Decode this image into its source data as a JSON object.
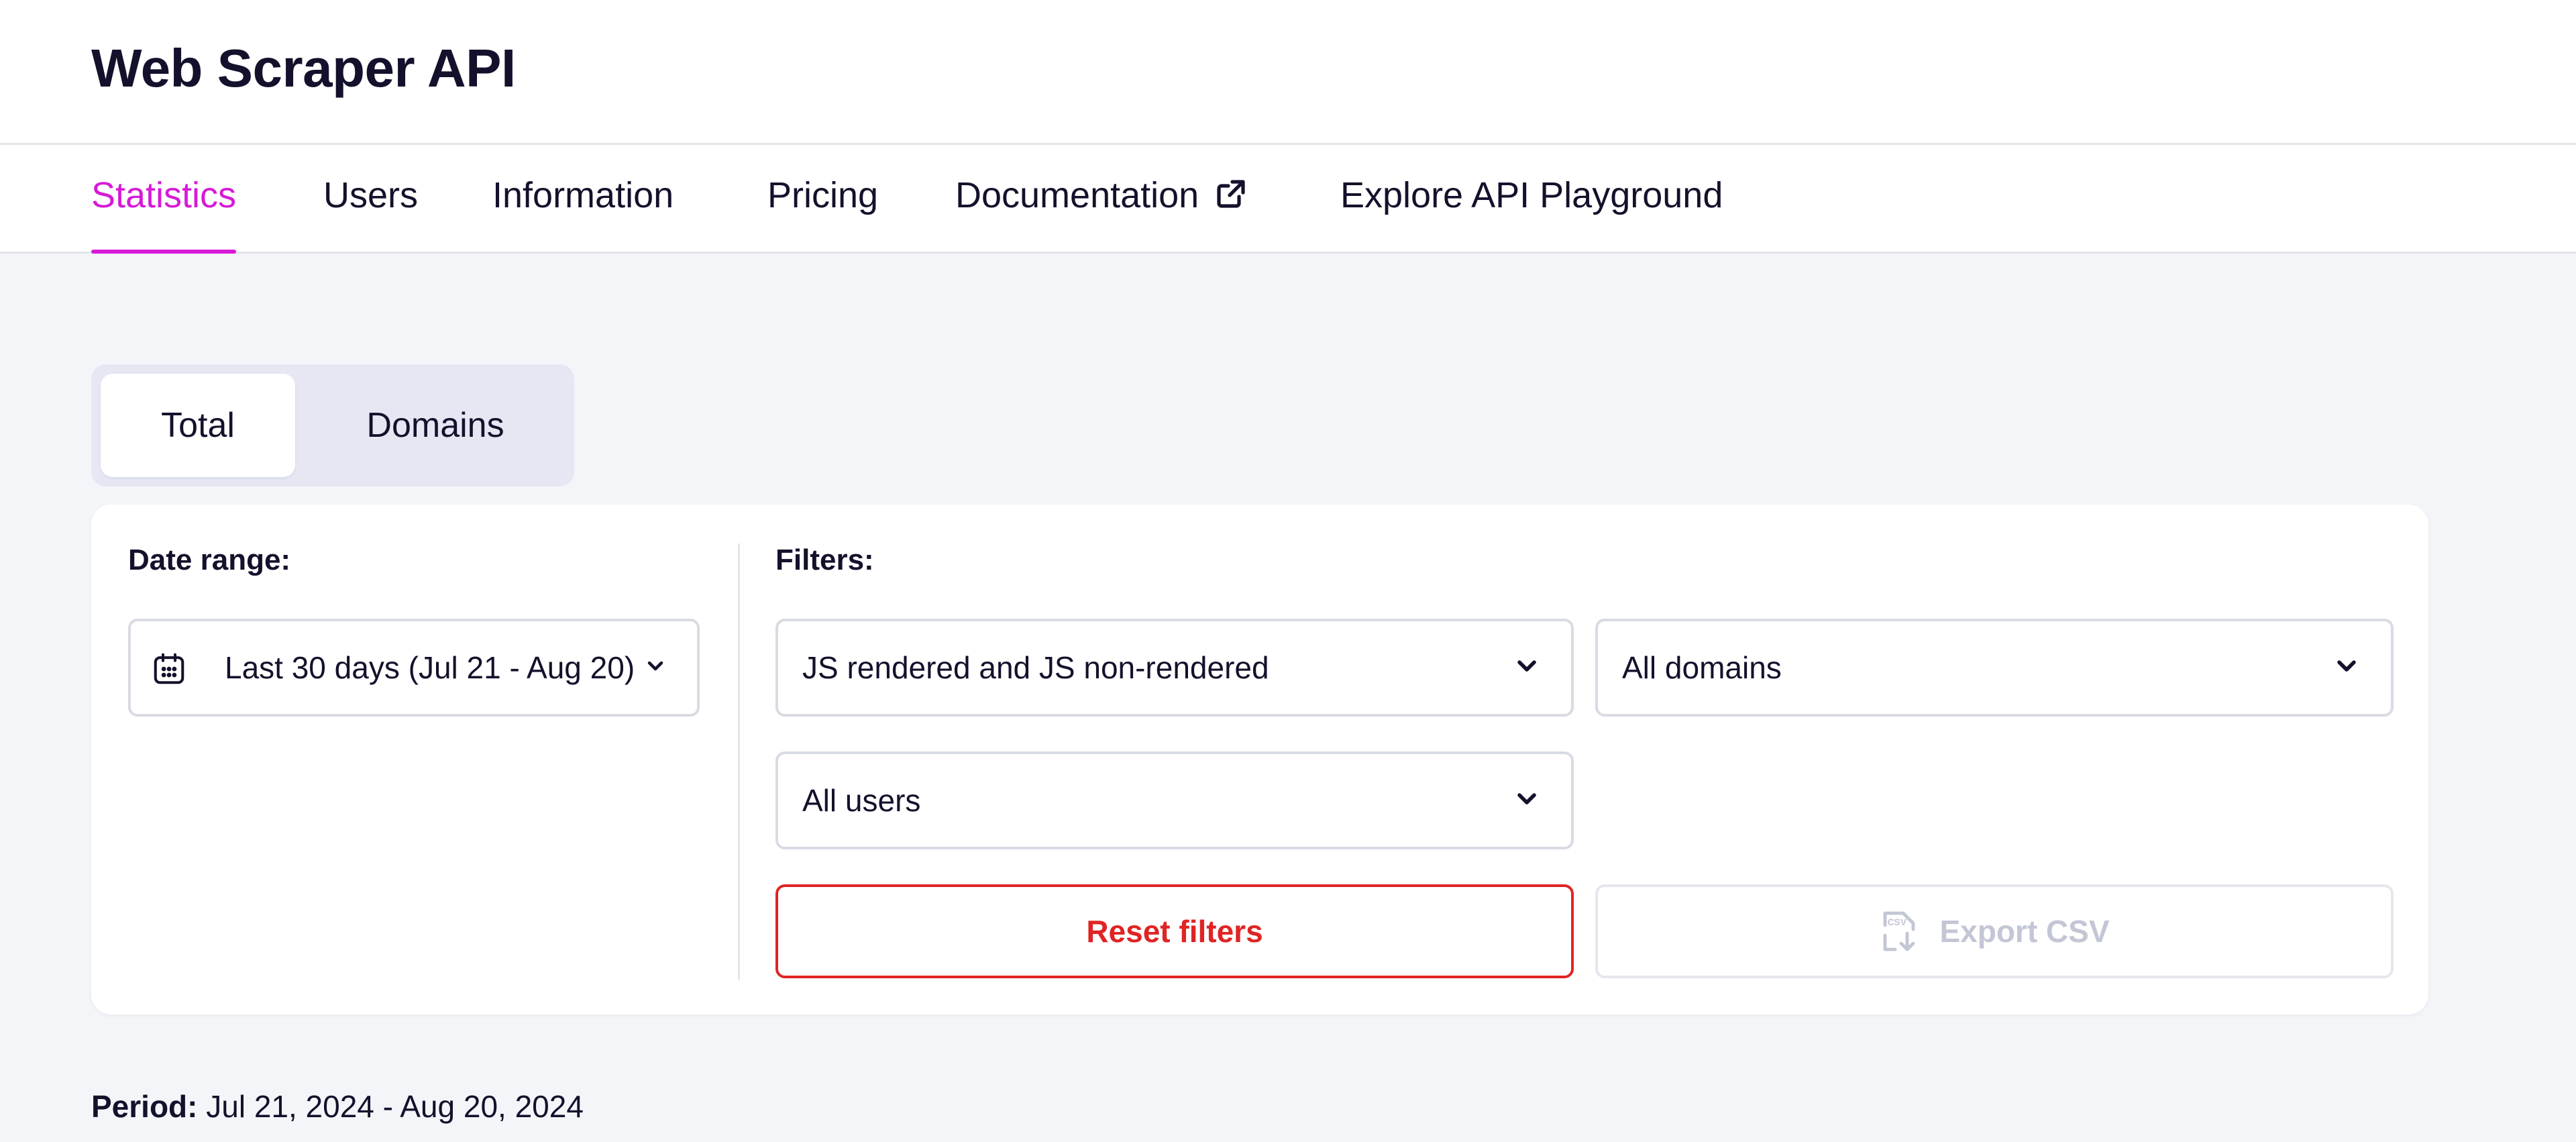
{
  "app": {
    "title": "Web Scraper API"
  },
  "tabs": [
    {
      "label": "Statistics",
      "active": true
    },
    {
      "label": "Users"
    },
    {
      "label": "Information"
    },
    {
      "label": "Pricing"
    },
    {
      "label": "Documentation",
      "icon": "external-link-icon"
    },
    {
      "label": "Explore API Playground"
    }
  ],
  "view_toggle": {
    "total": "Total",
    "domains": "Domains",
    "selected": "Total"
  },
  "date_range": {
    "label": "Date range:",
    "value": "Last 30 days (Jul 21 - Aug 20)",
    "icon": "calendar-icon"
  },
  "filters": {
    "label": "Filters:",
    "render_type": "JS rendered and JS non-rendered",
    "domain": "All domains",
    "user": "All users"
  },
  "actions": {
    "reset": "Reset filters",
    "export": "Export CSV",
    "export_icon": "csv-download-icon"
  },
  "period": {
    "label": "Period:",
    "value": "Jul 21, 2024 - Aug 20, 2024"
  },
  "colors": {
    "accent": "#d61ad6",
    "danger": "#e02424",
    "text": "#13112b",
    "background": "#f4f5f9",
    "disabled": "#c3c6d4"
  }
}
